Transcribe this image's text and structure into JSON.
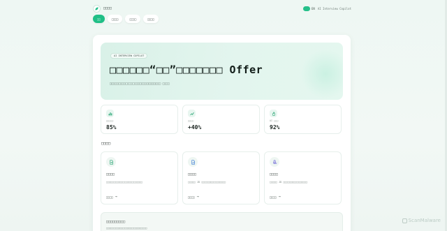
{
  "header": {
    "brand": "□□□□",
    "lang_en": "EN",
    "copilot": "AI Interview Copilot"
  },
  "nav": {
    "tabs": [
      {
        "label": "□□",
        "active": true
      },
      {
        "label": "□□□□",
        "active": false
      },
      {
        "label": "□□□□",
        "active": false
      },
      {
        "label": "□□□□",
        "active": false
      }
    ]
  },
  "hero": {
    "badge": "AI INTERVIEW COPILOT",
    "title": "□□□□□□“□□”□□□□□□□ Offer",
    "subtitle": "□□□□□□□□□□□□□□□□□□□□□□□□□□□□□ □□□□"
  },
  "stats": [
    {
      "icon": "bar-chart-icon",
      "label": "□□□□□",
      "value": "85%"
    },
    {
      "icon": "trend-up-icon",
      "label": "□□□□",
      "value": "+40%"
    },
    {
      "icon": "flame-icon",
      "label": "AI □□□",
      "value": "92%"
    }
  ],
  "section_title": "□□□□",
  "cards": [
    {
      "icon": "document-icon",
      "title": "□□□□",
      "desc": "□□□□□□□□□□□□□□□□□□□□□□□□",
      "link": "□□□□",
      "accent": "#2fa878"
    },
    {
      "icon": "file-check-icon",
      "title": "□□□□",
      "desc": "□□□□□ JD □□□□□□□□□□□□□□□□",
      "link": "□□□□",
      "accent": "#3a7bd5"
    },
    {
      "icon": "mic-edit-icon",
      "title": "□□□□",
      "desc": "□□□□□ JD □□□□□□□□□□□□□□□□",
      "link": "□□□□",
      "accent": "#6a5fd6"
    }
  ],
  "bottom": {
    "title": "□□□□□□□□□",
    "desc": "□□□□□□□□□□□□□□□□□□□□□□□□□□□"
  },
  "watermark": "ScanMalware",
  "colors": {
    "accent": "#1fbf86",
    "background": "#eef7f3",
    "text": "#1f2a26"
  }
}
